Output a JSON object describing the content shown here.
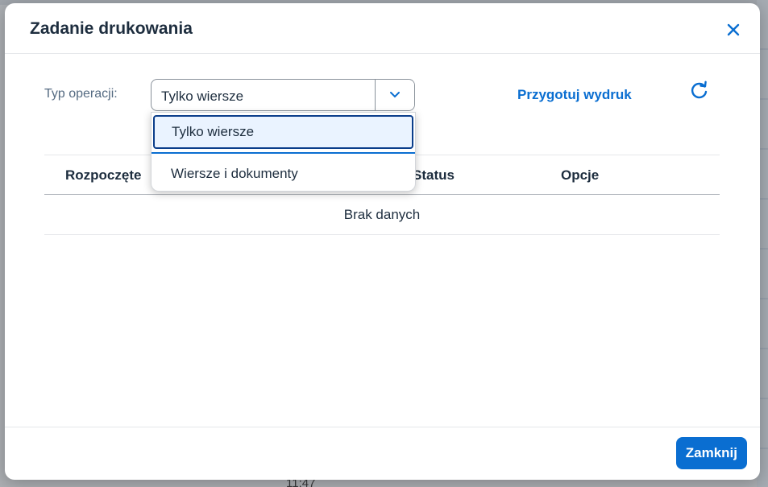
{
  "background": {
    "bottom_text": "11:47"
  },
  "dialog": {
    "title": "Zadanie drukowania",
    "close_icon": "close-icon"
  },
  "toolbar": {
    "operation_label": "Typ operacji:",
    "operation_value": "Tylko wiersze",
    "print_link": "Przygotuj wydruk",
    "refresh_icon": "refresh-icon"
  },
  "dropdown": {
    "options": [
      {
        "label": "Tylko wiersze",
        "selected": true
      },
      {
        "label": "Wiersze i dokumenty",
        "selected": false
      }
    ]
  },
  "table": {
    "columns": [
      "Rozpoczęte",
      "Status",
      "Opcje"
    ],
    "empty_text": "Brak danych"
  },
  "footer": {
    "close_button": "Zamknij"
  },
  "colors": {
    "accent": "#0a6ed1",
    "title": "#1d2d3e"
  }
}
